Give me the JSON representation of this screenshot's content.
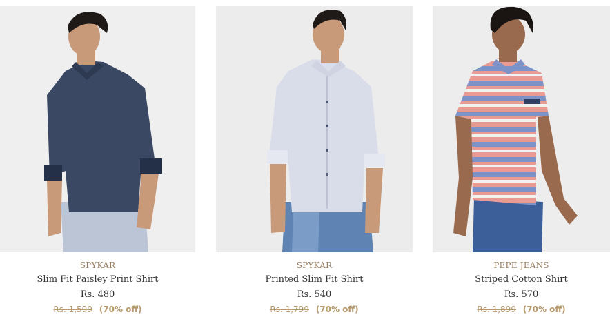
{
  "products": [
    {
      "brand": "SPYKAR",
      "title": "Slim Fit Paisley Print Shirt",
      "price": "Rs. 480",
      "mrp": "Rs. 1,599",
      "discount": "(70% off)",
      "image_alt": "model-wearing-navy-paisley-shirt"
    },
    {
      "brand": "SPYKAR",
      "title": "Printed Slim Fit Shirt",
      "price": "Rs. 540",
      "mrp": "Rs. 1,799",
      "discount": "(70% off)",
      "image_alt": "model-wearing-light-printed-shirt"
    },
    {
      "brand": "PEPE JEANS",
      "title": "Striped Cotton Shirt",
      "price": "Rs. 570",
      "mrp": "Rs. 1,899",
      "discount": "(70% off)",
      "image_alt": "model-wearing-striped-shirt"
    }
  ],
  "colors": {
    "brand_text": "#9a8061",
    "mrp_text": "#b79a6e",
    "title_text": "#333333",
    "photo_bg": "#ededed"
  }
}
